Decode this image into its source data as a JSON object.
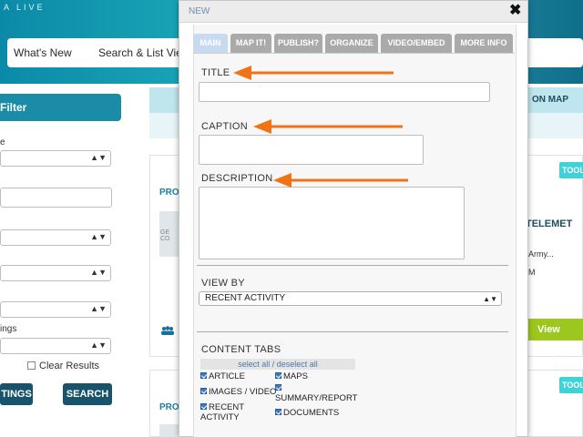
{
  "background": {
    "logo_text": "A LIVE",
    "nav": {
      "whats_new": "What's New",
      "search_list": "Search & List View"
    },
    "filter_title": "Filter",
    "filter_labels": [
      "e",
      "ings"
    ],
    "clear_results": "Clear Results",
    "left_button": "TINGS",
    "search_button": "SEARCH",
    "on_map": "ON MAP",
    "card_prefix": "PRO",
    "tool_button": "TOOL",
    "right_snippets": [
      "C TELEMET",
      "Army...",
      "M"
    ],
    "view_project": "View Proje",
    "thumb_caption": "GE CO"
  },
  "modal": {
    "title": "NEW",
    "close_symbol": "✖",
    "tabs": [
      {
        "label": "MAIN",
        "active": true
      },
      {
        "label": "MAP IT!",
        "active": false
      },
      {
        "label": "PUBLISH?",
        "active": false
      },
      {
        "label": "ORGANIZE",
        "active": false
      },
      {
        "label": "VIDEO/EMBED",
        "active": false
      },
      {
        "label": "MORE INFO",
        "active": false
      }
    ],
    "title_label": "TITLE",
    "title_value": "",
    "caption_label": "CAPTION",
    "caption_value": "",
    "description_label": "DESCRIPTION",
    "description_value": "",
    "view_by_label": "VIEW BY",
    "view_by_selected": "RECENT ACTIVITY",
    "content_tabs_label": "CONTENT TABS",
    "select_all": "select all / deselect all",
    "checkboxes": [
      {
        "label": "ARTICLE",
        "checked": true
      },
      {
        "label": "MAPS",
        "checked": true
      },
      {
        "label": "IMAGES / VIDEO",
        "checked": true
      },
      {
        "label": "SUMMARY/REPORT",
        "checked": true
      },
      {
        "label": "RECENT ACTIVITY",
        "checked": true
      },
      {
        "label": "DOCUMENTS",
        "checked": true
      }
    ]
  },
  "colors": {
    "arrow": "#f07318",
    "tab_active": "#c7daf0",
    "tab_inactive": "#aaaaaa",
    "banner": "#1aa6b8",
    "view_project": "#9cc71e"
  }
}
